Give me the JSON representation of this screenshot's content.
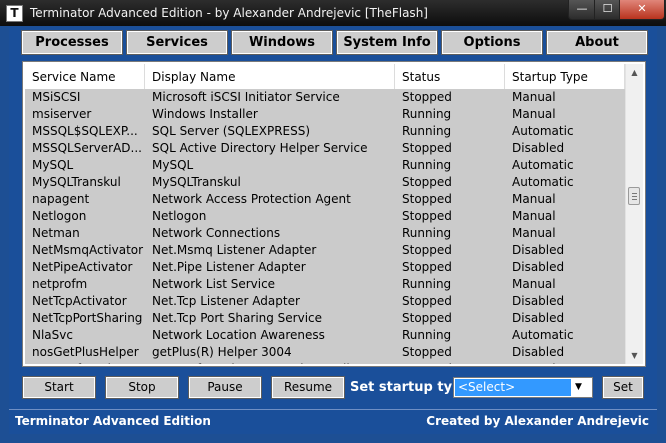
{
  "window": {
    "title": "Terminator Advanced Edition - by Alexander Andrejevic [TheFlash]",
    "icon_letter": "T",
    "controls": {
      "minimize": "—",
      "maximize": "☐",
      "close": "✕"
    }
  },
  "menu": [
    {
      "id": "processes",
      "label": "Processes"
    },
    {
      "id": "services",
      "label": "Services"
    },
    {
      "id": "windows",
      "label": "Windows"
    },
    {
      "id": "system-info",
      "label": "System Info"
    },
    {
      "id": "options",
      "label": "Options"
    },
    {
      "id": "about",
      "label": "About"
    }
  ],
  "table": {
    "columns": [
      "Service Name",
      "Display Name",
      "Status",
      "Startup Type"
    ],
    "rows": [
      [
        "MSiSCSI",
        "Microsoft iSCSI Initiator Service",
        "Stopped",
        "Manual"
      ],
      [
        "msiserver",
        "Windows Installer",
        "Running",
        "Manual"
      ],
      [
        "MSSQL$SQLEXP...",
        "SQL Server (SQLEXPRESS)",
        "Running",
        "Automatic"
      ],
      [
        "MSSQLServerAD...",
        "SQL Active Directory Helper Service",
        "Stopped",
        "Disabled"
      ],
      [
        "MySQL",
        "MySQL",
        "Running",
        "Automatic"
      ],
      [
        "MySQLTranskul",
        "MySQLTranskul",
        "Stopped",
        "Automatic"
      ],
      [
        "napagent",
        "Network Access Protection Agent",
        "Stopped",
        "Manual"
      ],
      [
        "Netlogon",
        "Netlogon",
        "Stopped",
        "Manual"
      ],
      [
        "Netman",
        "Network Connections",
        "Running",
        "Manual"
      ],
      [
        "NetMsmqActivator",
        "Net.Msmq Listener Adapter",
        "Stopped",
        "Disabled"
      ],
      [
        "NetPipeActivator",
        "Net.Pipe Listener Adapter",
        "Stopped",
        "Disabled"
      ],
      [
        "netprofm",
        "Network List Service",
        "Running",
        "Manual"
      ],
      [
        "NetTcpActivator",
        "Net.Tcp Listener Adapter",
        "Stopped",
        "Disabled"
      ],
      [
        "NetTcpPortSharing",
        "Net.Tcp Port Sharing Service",
        "Stopped",
        "Disabled"
      ],
      [
        "NlaSvc",
        "Network Location Awareness",
        "Running",
        "Automatic"
      ],
      [
        "nosGetPlusHelper",
        "getPlus(R) Helper 3004",
        "Stopped",
        "Disabled"
      ],
      [
        "NovacoftBackup",
        "Novacoft Backup Network Coordinator",
        "Stopped",
        "Manual"
      ]
    ]
  },
  "scrollbar": {
    "up": "▲",
    "down": "▼"
  },
  "actions": {
    "start": "Start",
    "stop": "Stop",
    "pause": "Pause",
    "resume": "Resume",
    "startup_label": "Set startup type:",
    "startup_selected": "<Select>",
    "select_arrow": "▼",
    "set": "Set"
  },
  "status": {
    "left": "Terminator Advanced Edition",
    "right": "Created by Alexander Andrejevic"
  }
}
